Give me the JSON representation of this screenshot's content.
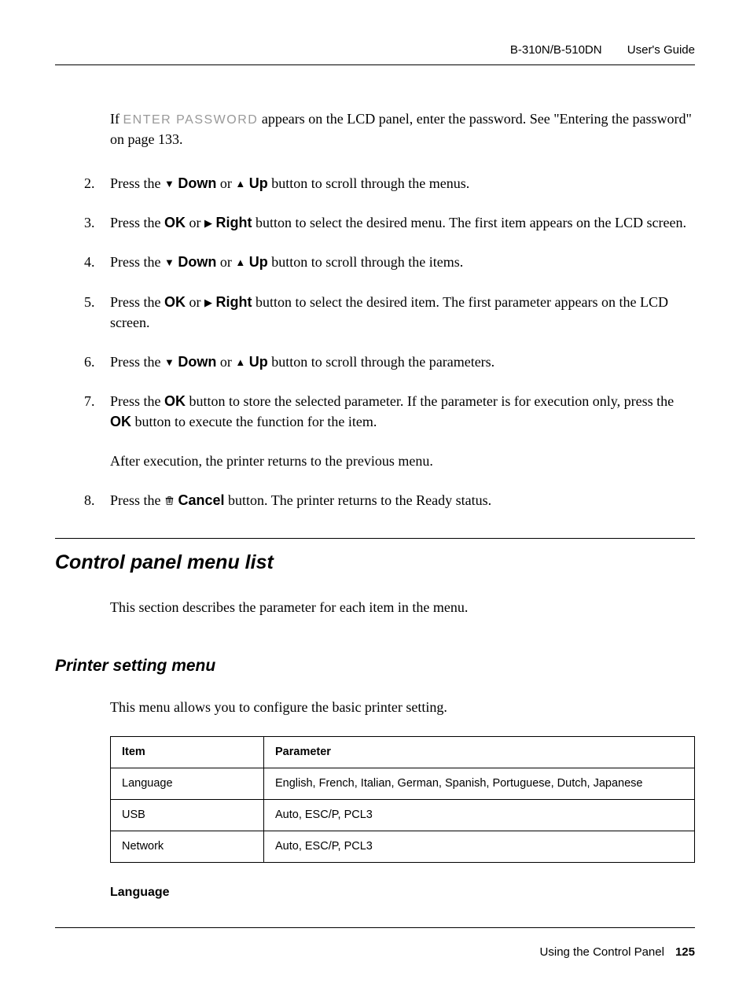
{
  "header": {
    "model": "B-310N/B-510DN",
    "doc_title": "User's Guide"
  },
  "note": {
    "prefix": "If ",
    "lcd": "ENTER PASSWORD",
    "text": " appears on the LCD panel, enter the password. See \"Entering the password\" on page 133."
  },
  "steps": [
    {
      "n": "2.",
      "parts": [
        "Press the ",
        "▼",
        " ",
        "Down",
        " or ",
        "▲",
        " ",
        "Up",
        " button to scroll through the menus."
      ]
    },
    {
      "n": "3.",
      "parts": [
        "Press the ",
        "OK",
        " or ",
        "▶",
        " ",
        "Right",
        " button to select the desired menu. The first item appears on the LCD screen."
      ]
    },
    {
      "n": "4.",
      "parts": [
        "Press the ",
        "▼",
        " ",
        "Down",
        " or ",
        "▲",
        " ",
        "Up",
        " button to scroll through the items."
      ]
    },
    {
      "n": "5.",
      "parts": [
        "Press the ",
        "OK",
        " or ",
        "▶",
        " ",
        "Right",
        " button to select the desired item. The first parameter appears on the LCD screen."
      ]
    },
    {
      "n": "6.",
      "parts": [
        "Press the ",
        "▼",
        " ",
        "Down",
        " or ",
        "▲",
        " ",
        "Up",
        " button to scroll through the parameters."
      ]
    },
    {
      "n": "7.",
      "parts": [
        "Press the ",
        "OK",
        " button to store the selected parameter. If the parameter is for execution only, press the ",
        "OK",
        " button to execute the function for the item."
      ],
      "after": "After execution, the printer returns to the previous menu."
    },
    {
      "n": "8.",
      "parts": [
        "Press the ",
        "🗑",
        " ",
        "Cancel",
        " button. The printer returns to the Ready status."
      ]
    }
  ],
  "h2": "Control panel menu list",
  "h2_para": "This section describes the parameter for each item in the menu.",
  "h3": "Printer setting menu",
  "h3_para": "This menu allows you to configure the basic printer setting.",
  "table": {
    "headers": [
      "Item",
      "Parameter"
    ],
    "rows": [
      [
        "Language",
        "English, French, Italian, German, Spanish, Portuguese, Dutch, Japanese"
      ],
      [
        "USB",
        "Auto, ESC/P, PCL3"
      ],
      [
        "Network",
        "Auto, ESC/P, PCL3"
      ]
    ]
  },
  "h4": "Language",
  "footer": {
    "section": "Using the Control Panel",
    "page": "125"
  }
}
